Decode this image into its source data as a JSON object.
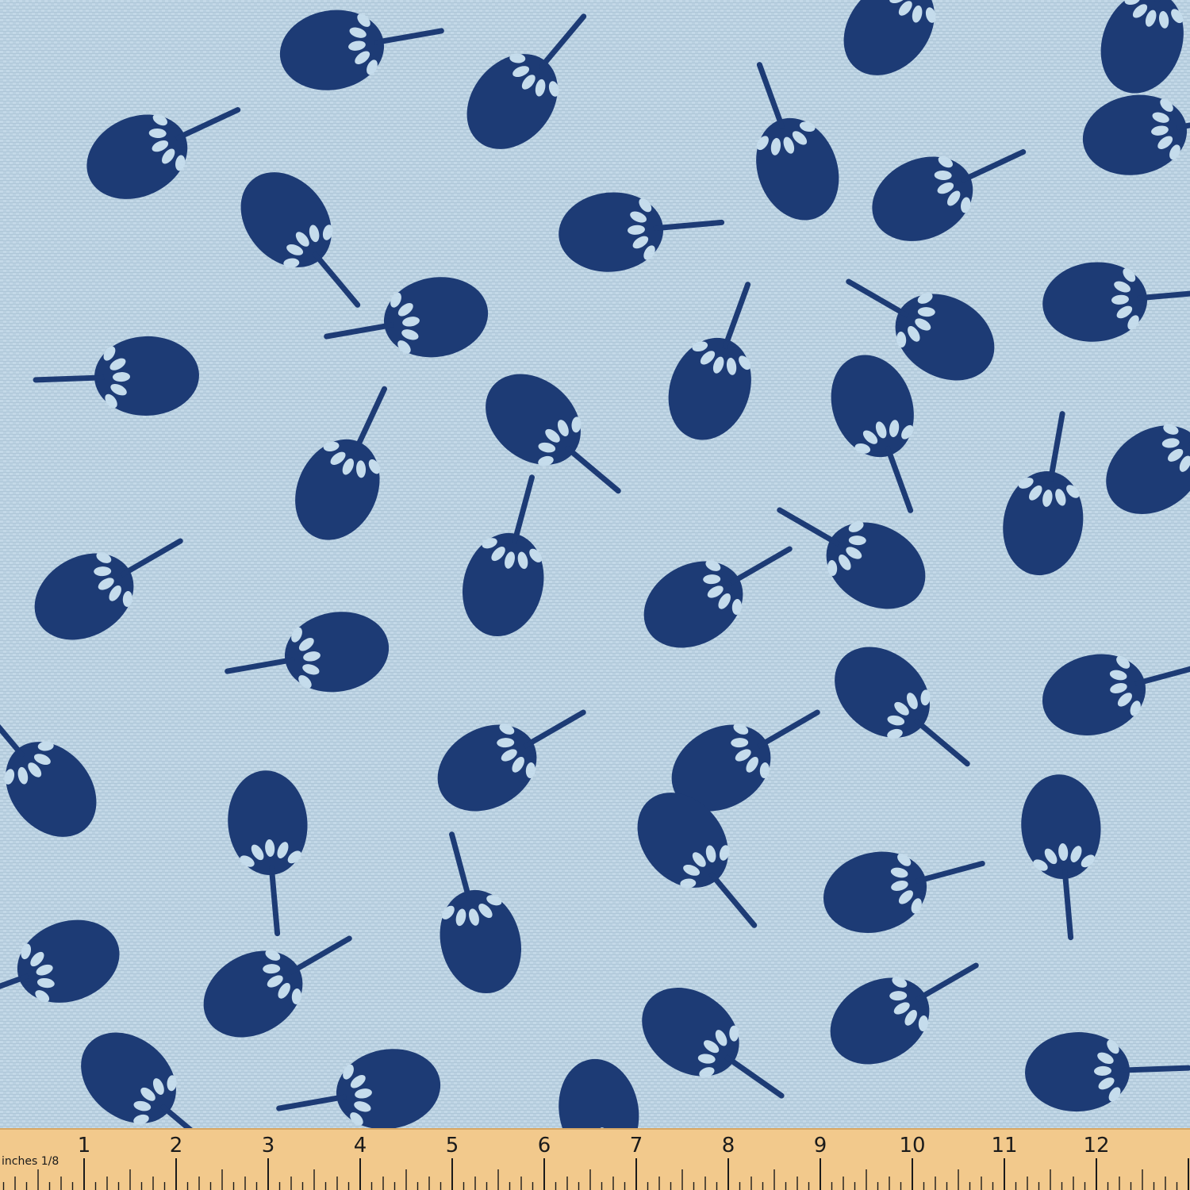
{
  "scene": {
    "description_colors": {
      "background": "#b9d0e0",
      "pattern": "#1d3b75",
      "highlight": "#c5dcec",
      "ruler": "#f2c98c",
      "ruler_ink": "#1b1b1b"
    },
    "icon": "japanese-uchiwa-fan-icon"
  },
  "ruler": {
    "unit_label": "inches 1/8",
    "numbers": [
      "1",
      "2",
      "3",
      "4",
      "5",
      "6",
      "7",
      "8",
      "9",
      "10",
      "11",
      "12",
      "1"
    ]
  }
}
